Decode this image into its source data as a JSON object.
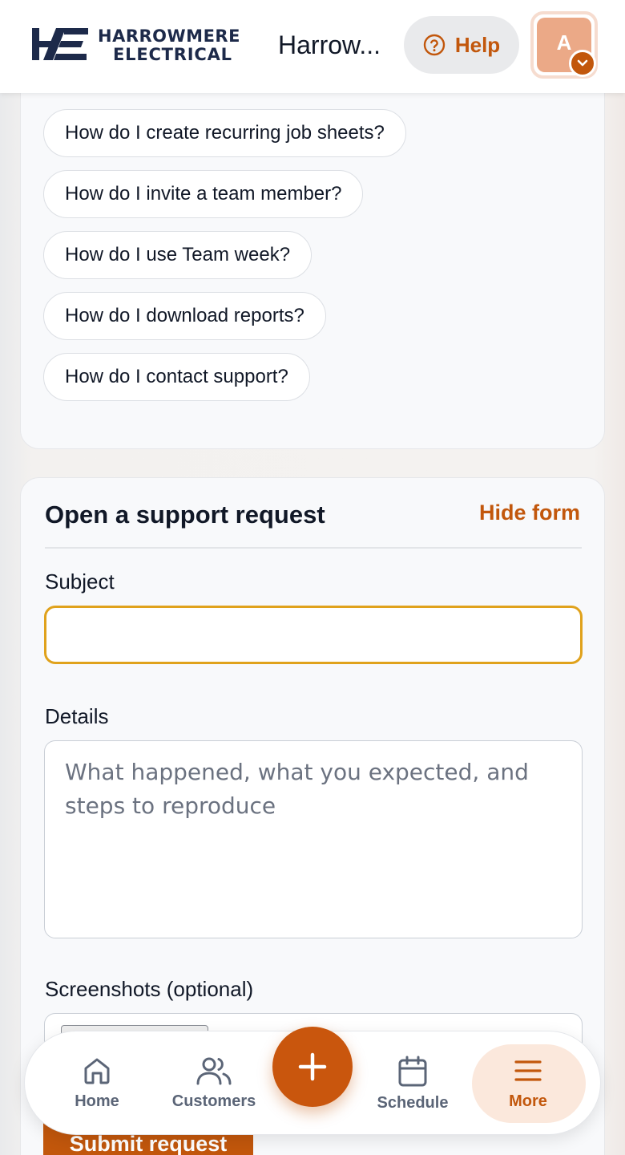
{
  "header": {
    "brand_line1": "HARROWMERE",
    "brand_line2": "ELECTRICAL",
    "workspace_name": "Harrow...",
    "help_label": "Help",
    "avatar_initial": "A"
  },
  "suggestions": [
    "How do I create recurring job sheets?",
    "How do I invite a team member?",
    "How do I use Team week?",
    "How do I download reports?",
    "How do I contact support?"
  ],
  "support_form": {
    "title": "Open a support request",
    "hide_label": "Hide form",
    "subject_label": "Subject",
    "subject_value": "",
    "details_label": "Details",
    "details_placeholder": "What happened, what you expected, and steps to reproduce",
    "screenshots_label": "Screenshots (optional)",
    "submit_label": "Submit request"
  },
  "bottom_nav": {
    "home": "Home",
    "customers": "Customers",
    "schedule": "Schedule",
    "more": "More"
  },
  "colors": {
    "accent": "#c2570c",
    "focus_border": "#e0a21c",
    "brand_navy": "#1d2a4a"
  }
}
